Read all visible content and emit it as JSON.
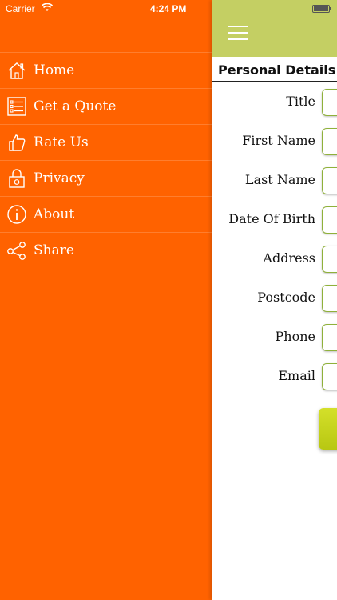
{
  "status_bar": {
    "carrier": "Carrier",
    "time": "4:24 PM"
  },
  "sidebar": {
    "items": [
      {
        "label": "Home",
        "icon": "home-icon"
      },
      {
        "label": "Get a Quote",
        "icon": "quote-list-icon"
      },
      {
        "label": "Rate Us",
        "icon": "thumbs-up-icon"
      },
      {
        "label": "Privacy",
        "icon": "lock-icon"
      },
      {
        "label": "About",
        "icon": "info-icon"
      },
      {
        "label": "Share",
        "icon": "share-icon"
      }
    ]
  },
  "main": {
    "section_title": "Personal Details",
    "fields": [
      {
        "label": "Title"
      },
      {
        "label": "First Name"
      },
      {
        "label": "Last Name"
      },
      {
        "label": "Date Of Birth"
      },
      {
        "label": "Address"
      },
      {
        "label": "Postcode"
      },
      {
        "label": "Phone"
      },
      {
        "label": "Email"
      }
    ]
  },
  "colors": {
    "sidebar": "#ff6200",
    "navbar": "#c4cf63",
    "input_border": "#8fb13a",
    "button": "#c9d51e"
  }
}
